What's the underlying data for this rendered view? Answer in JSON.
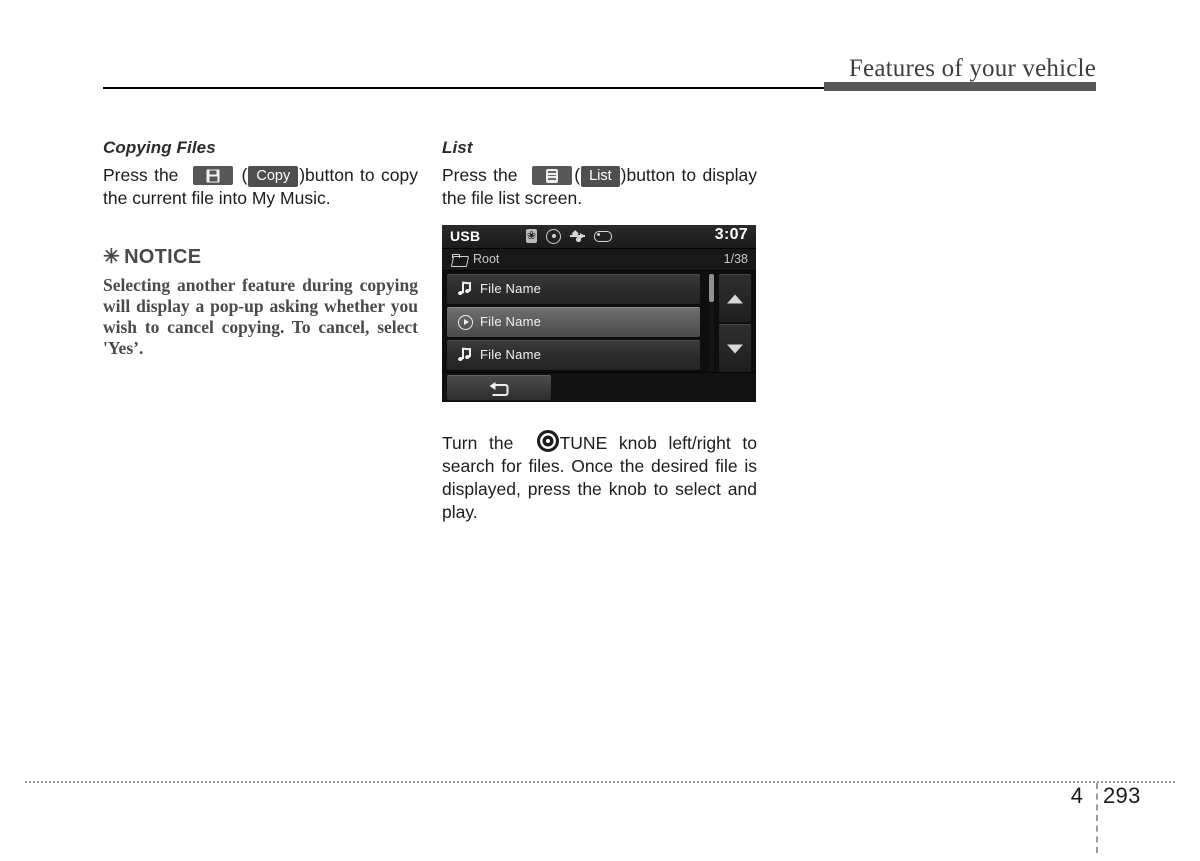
{
  "header": {
    "title": "Features of your vehicle"
  },
  "left_column": {
    "section_heading": "Copying Files",
    "paragraph_part1": "Press the",
    "key_icon_name": "copy-key-icon",
    "paren_open": "(",
    "soft_key_label": "Copy",
    "paren_close": ")",
    "paragraph_part2": "button to copy the current file into My Music."
  },
  "notice": {
    "asterisk": "✳",
    "heading": "NOTICE",
    "body": "Selecting another feature during copying will display a pop-up asking whether you wish to cancel copying. To cancel, select 'Yes’."
  },
  "right_column": {
    "section_heading": "List",
    "paragraph_part1": "Press the",
    "key_icon_name": "list-key-icon",
    "paren_open": "(",
    "soft_key_label": "List",
    "paren_close": ")",
    "paragraph_part2": "button to display the file list screen.",
    "tune_paragraph_part1": "Turn the",
    "tune_knob_icon_name": "tune-knob-icon",
    "tune_paragraph_part2": "TUNE knob left/right to search for files. Once the desired file is displayed, press the knob to select and play."
  },
  "device_screenshot": {
    "status_bar": {
      "source_label": "USB",
      "icons": [
        "bluetooth-icon",
        "circle-dot-icon",
        "usb-icon",
        "pill-icon"
      ],
      "clock": "3:07"
    },
    "path_bar": {
      "folder_icon": "open-folder-icon",
      "path_label": "Root",
      "item_count": "1/38"
    },
    "file_rows": [
      {
        "icon": "music-note-icon",
        "label": "File Name",
        "selected": false
      },
      {
        "icon": "play-circle-icon",
        "label": "File Name",
        "selected": true
      },
      {
        "icon": "music-note-icon",
        "label": "File Name",
        "selected": false
      }
    ],
    "scroll": {
      "up_icon": "chevron-up-icon",
      "down_icon": "chevron-down-icon"
    },
    "bottom_bar": {
      "back_icon": "back-arrow-icon"
    }
  },
  "footer": {
    "chapter": "4",
    "page": "293"
  },
  "colors": {
    "header_bar": "#585858",
    "header_text": "#3d3d3d",
    "notice_text": "#4a4a4a",
    "body_text": "#1c1c1c",
    "device_background": "#0e0e0e",
    "device_row": "#2b2b2b",
    "device_row_selected": "#5b5b5b",
    "device_accent_text": "#ffffff"
  }
}
